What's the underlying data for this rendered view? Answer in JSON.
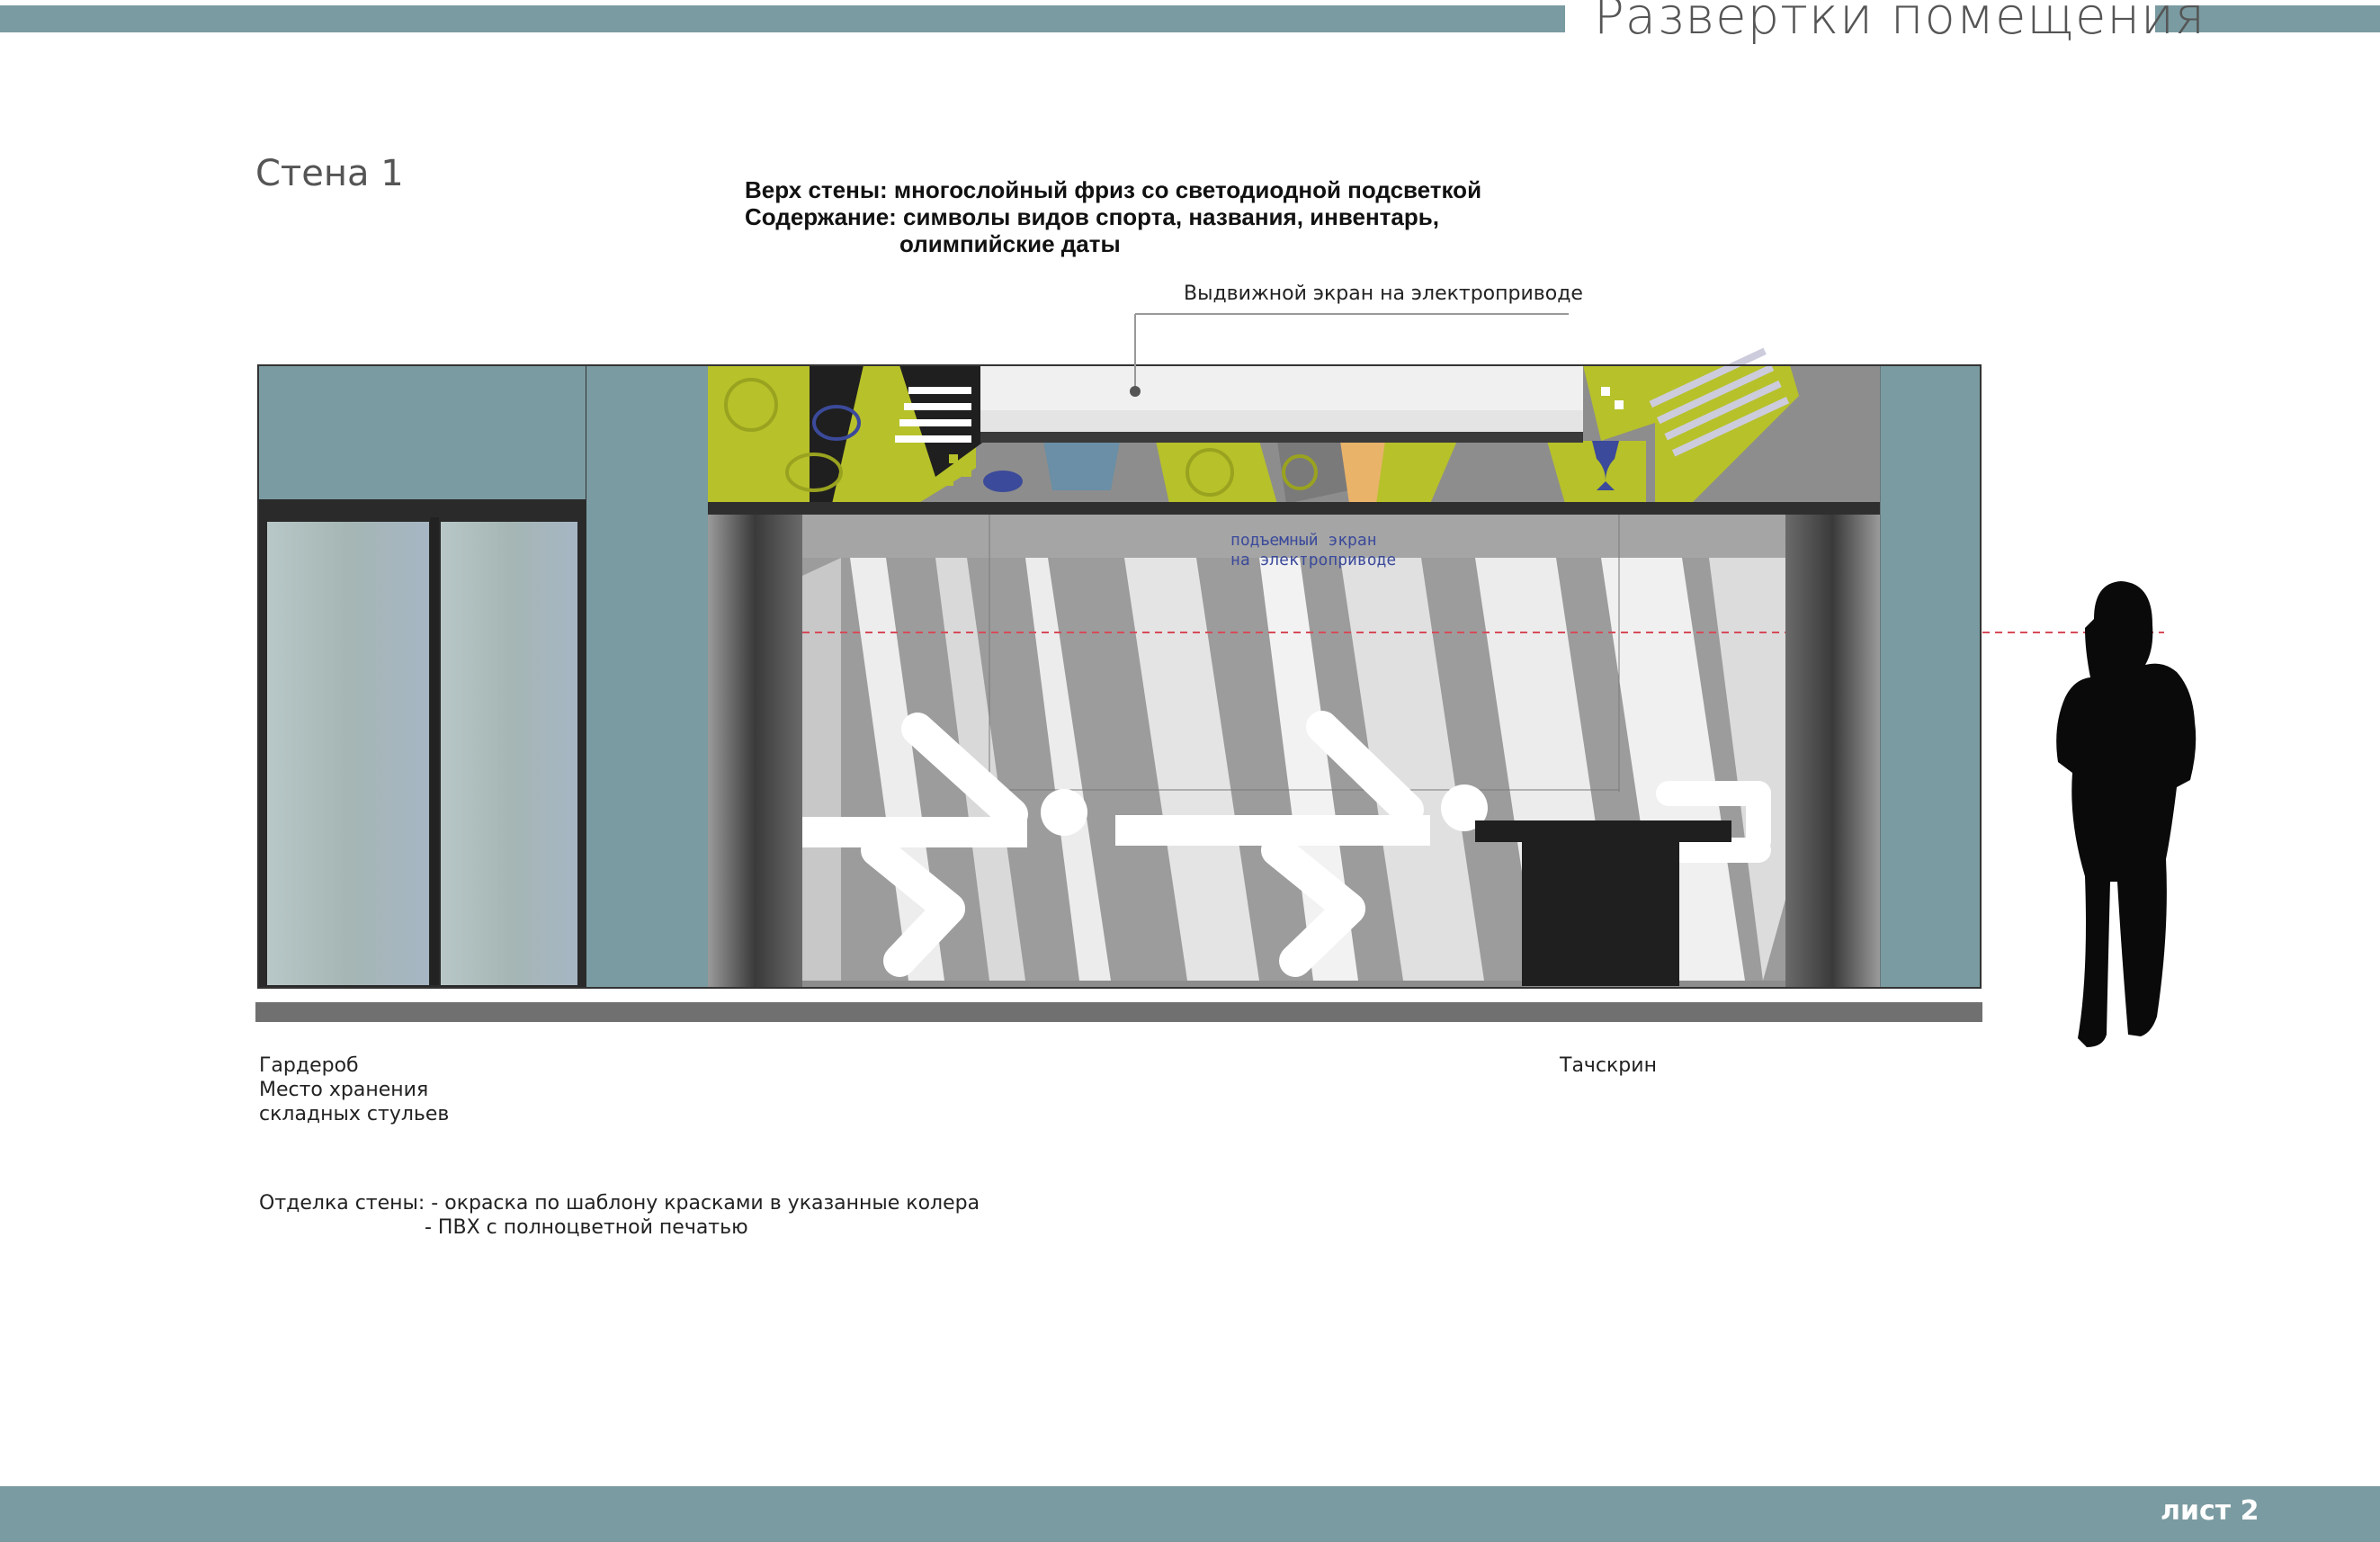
{
  "header": {
    "title": "Развертки помещения"
  },
  "wall": {
    "label": "Стена 1"
  },
  "description": {
    "line1": "Верх стены: многослойный фриз со светодиодной подсветкой",
    "line2": "Содержание: символы видов спорта, названия, инвентарь,",
    "line3": "олимпийские даты"
  },
  "callouts": {
    "retractable_screen": "Выдвижной экран на электроприводе",
    "lift_screen_1": "подъемный экран",
    "lift_screen_2": "на электроприводе",
    "touchscreen": "Тачскрин"
  },
  "wardrobe": {
    "line1": "Гардероб",
    "line2": "Место хранения",
    "line3": "складных стульев"
  },
  "finish": {
    "line1": "Отделка стены: - окраска по шаблону  красками в указанные колера",
    "line2": "- ПВХ с полноцветной печатью"
  },
  "footer": {
    "sheet": "лист 2"
  },
  "colors": {
    "teal": "#7a9ba1",
    "lime": "#b7c12a",
    "dark": "#1f1f1f",
    "frieze_gray": "#8d8d8d",
    "accent_blue": "#3b4a9a"
  }
}
